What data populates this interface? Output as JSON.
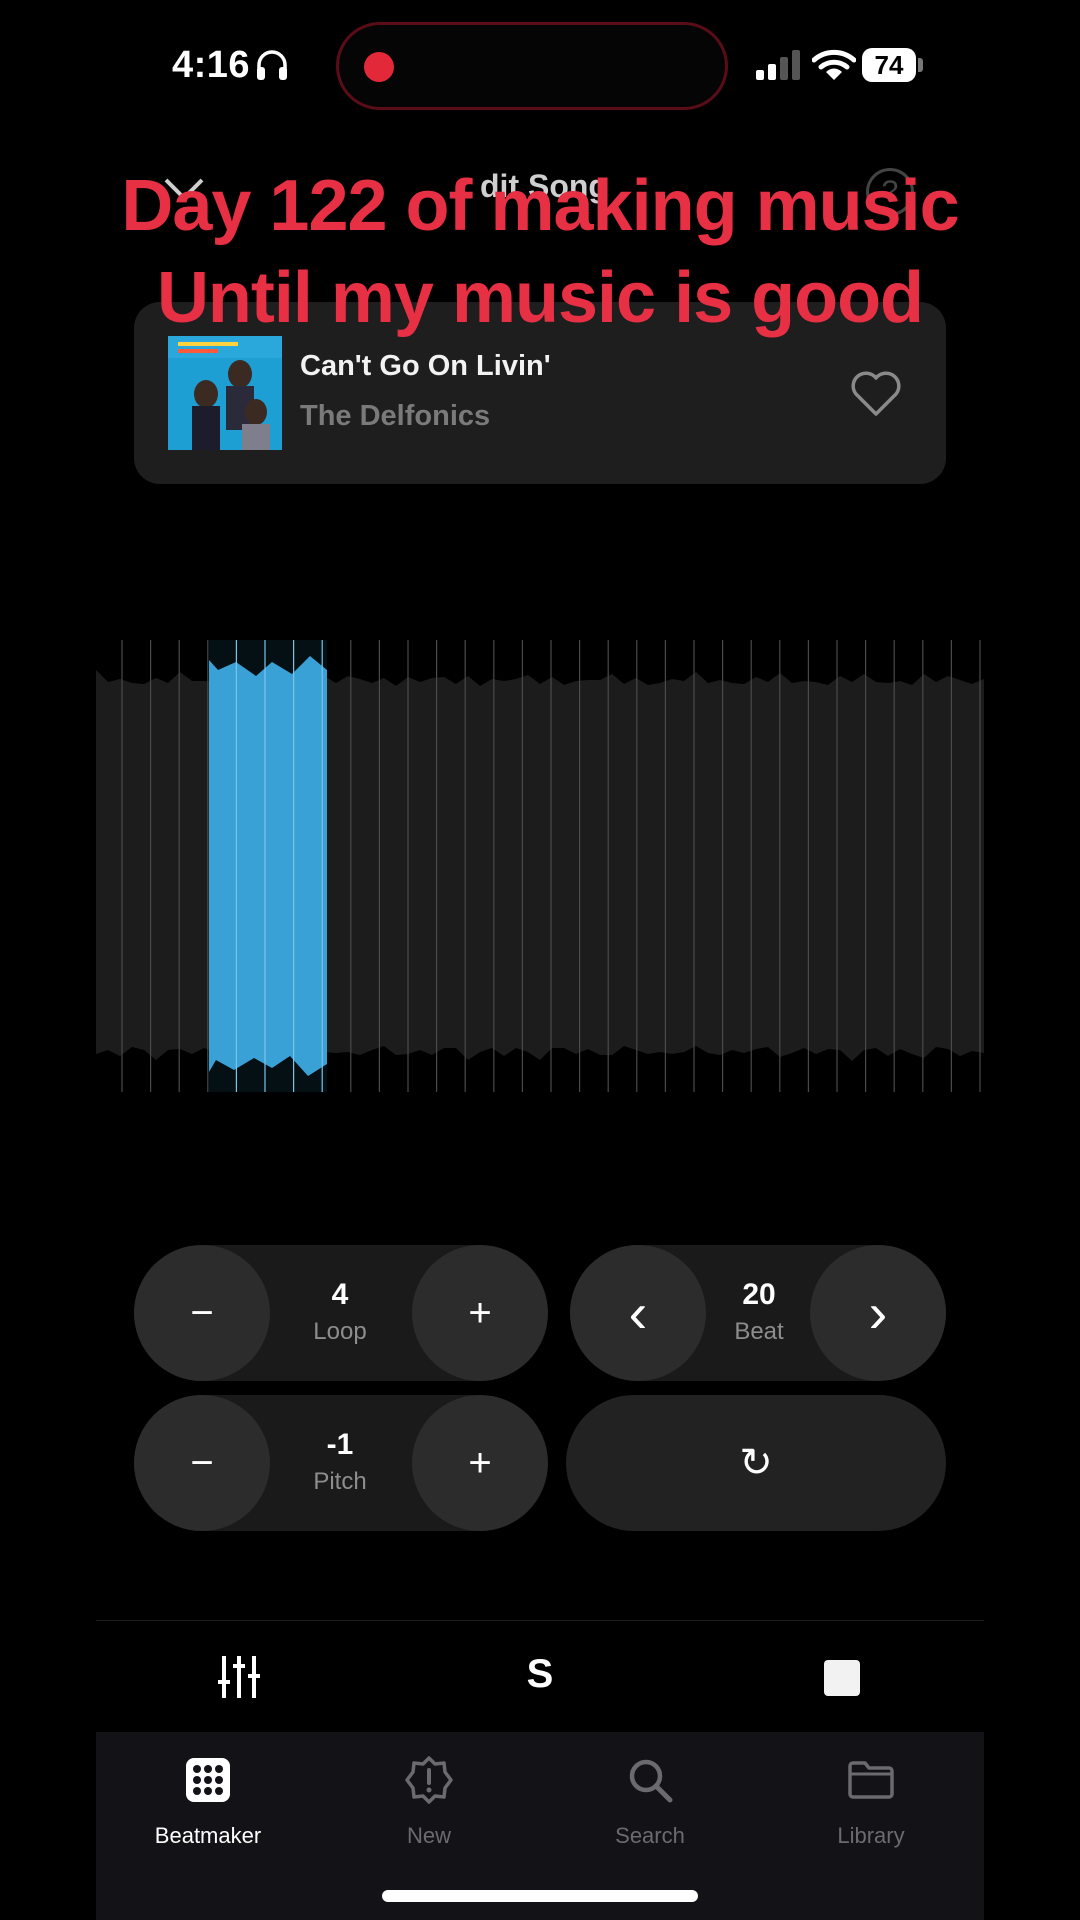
{
  "status_bar": {
    "time": "4:16",
    "battery": "74",
    "recording_color": "#e3283a"
  },
  "header": {
    "title": "dit Song",
    "help_glyph": "?",
    "close_icon": "close-icon",
    "help_icon": "question-circle-icon"
  },
  "overlay": {
    "line1": "Day 122 of making music",
    "line2": "Until my music is good",
    "color": "#e83045"
  },
  "song": {
    "title": "Can't Go On Livin'",
    "artist": "The Delfonics",
    "favorite_icon": "heart-icon"
  },
  "waveform": {
    "selection_color": "#3aa1d6"
  },
  "controls": {
    "loop": {
      "value": "4",
      "label": "Loop"
    },
    "beat": {
      "value": "20",
      "label": "Beat"
    },
    "pitch": {
      "value": "-1",
      "label": "Pitch"
    },
    "minus_glyph": "−",
    "plus_glyph": "+",
    "prev_glyph": "‹",
    "next_glyph": "›",
    "reset_glyph": "↻"
  },
  "toolbar": {
    "center_label": "S",
    "left_icon": "sliders-icon",
    "right_icon": "stop-icon"
  },
  "tabs": [
    {
      "label": "Beatmaker",
      "icon": "grid-icon",
      "active": true
    },
    {
      "label": "New",
      "icon": "badge-alert-icon",
      "active": false
    },
    {
      "label": "Search",
      "icon": "search-icon",
      "active": false
    },
    {
      "label": "Library",
      "icon": "folder-icon",
      "active": false
    }
  ]
}
